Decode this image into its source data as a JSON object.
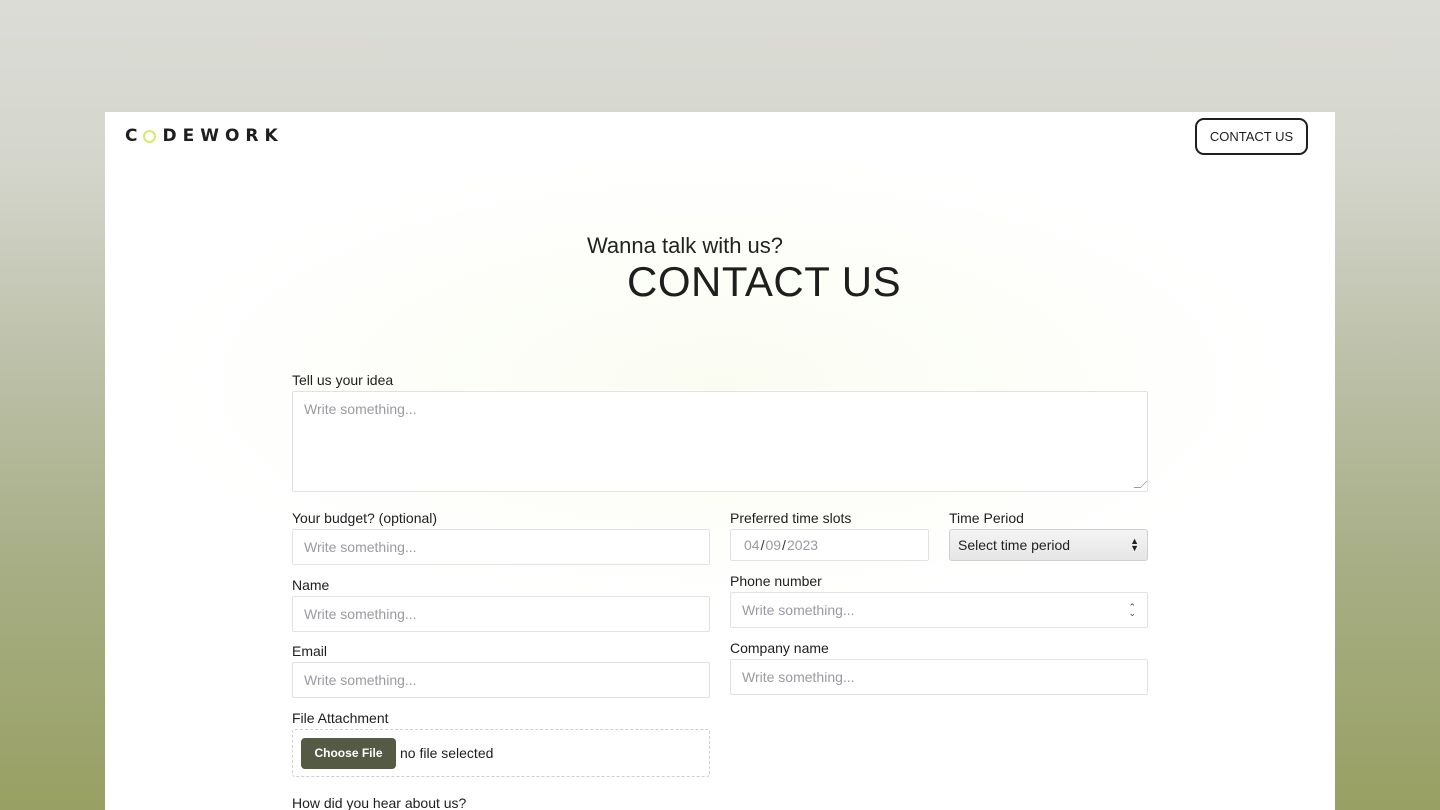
{
  "brand": {
    "logo_text_left": "C",
    "logo_text_right": "DEWORK"
  },
  "nav": {
    "contact_button": "CONTACT US"
  },
  "hero": {
    "subtitle": "Wanna talk with us?",
    "title": "CONTACT US"
  },
  "form": {
    "idea": {
      "label": "Tell us your idea",
      "placeholder": "Write something..."
    },
    "budget": {
      "label": "Your budget? (optional)",
      "placeholder": "Write something..."
    },
    "time_slots": {
      "label": "Preferred time slots",
      "month": "04",
      "day": "09",
      "year": "2023"
    },
    "time_period": {
      "label": "Time Period",
      "selected": "Select time period"
    },
    "name": {
      "label": "Name",
      "placeholder": "Write something..."
    },
    "phone": {
      "label": "Phone number",
      "placeholder": "Write something..."
    },
    "email": {
      "label": "Email",
      "placeholder": "Write something..."
    },
    "company": {
      "label": "Company name",
      "placeholder": "Write something..."
    },
    "attachment": {
      "label": "File Attachment",
      "button": "Choose File",
      "status": "no file selected"
    },
    "hear_about": {
      "label": "How did you hear about us?"
    }
  },
  "colors": {
    "accent": "#e8f57e",
    "file_button": "#555a44",
    "text": "#1e1e1e"
  }
}
